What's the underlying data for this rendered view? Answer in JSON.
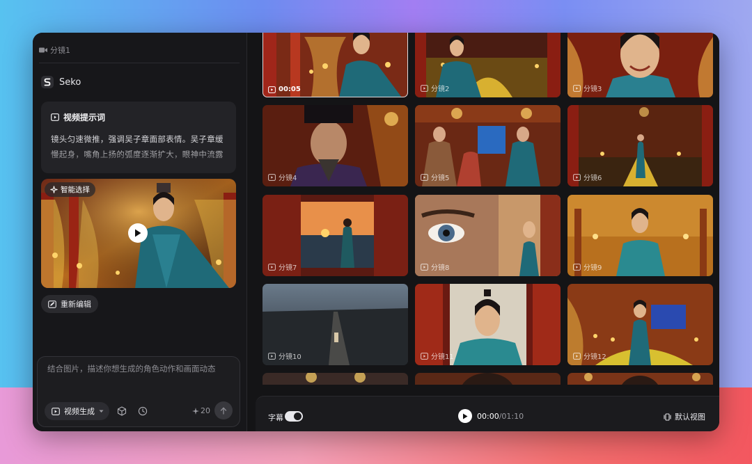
{
  "left_panel": {
    "shot_header": "分镜1",
    "brand": "Seko",
    "prompt_card": {
      "title": "视频提示词",
      "text": "镜头匀速微推，强调吴子章面部表情。吴子章缓慢起身，嘴角上扬的弧度逐渐扩大，眼神中流露"
    },
    "preview": {
      "chip_label": "智能选择"
    },
    "reedit_label": "重新编辑",
    "composer": {
      "placeholder": "结合图片，描述你想生成的角色动作和画面动态",
      "mode_label": "视频生成",
      "credits": "20"
    }
  },
  "grid": {
    "tiles": [
      {
        "label": "00:05",
        "selected": true
      },
      {
        "label": "分镜2"
      },
      {
        "label": "分镜3"
      },
      {
        "label": "分镜4"
      },
      {
        "label": "分镜5"
      },
      {
        "label": "分镜6"
      },
      {
        "label": "分镜7"
      },
      {
        "label": "分镜8"
      },
      {
        "label": "分镜9"
      },
      {
        "label": "分镜10"
      },
      {
        "label": "分镜11"
      },
      {
        "label": "分镜12"
      }
    ]
  },
  "playbar": {
    "subtitle_label": "字幕",
    "current_time": "00:00",
    "total_time": "/01:10",
    "view_label": "默认视图"
  }
}
